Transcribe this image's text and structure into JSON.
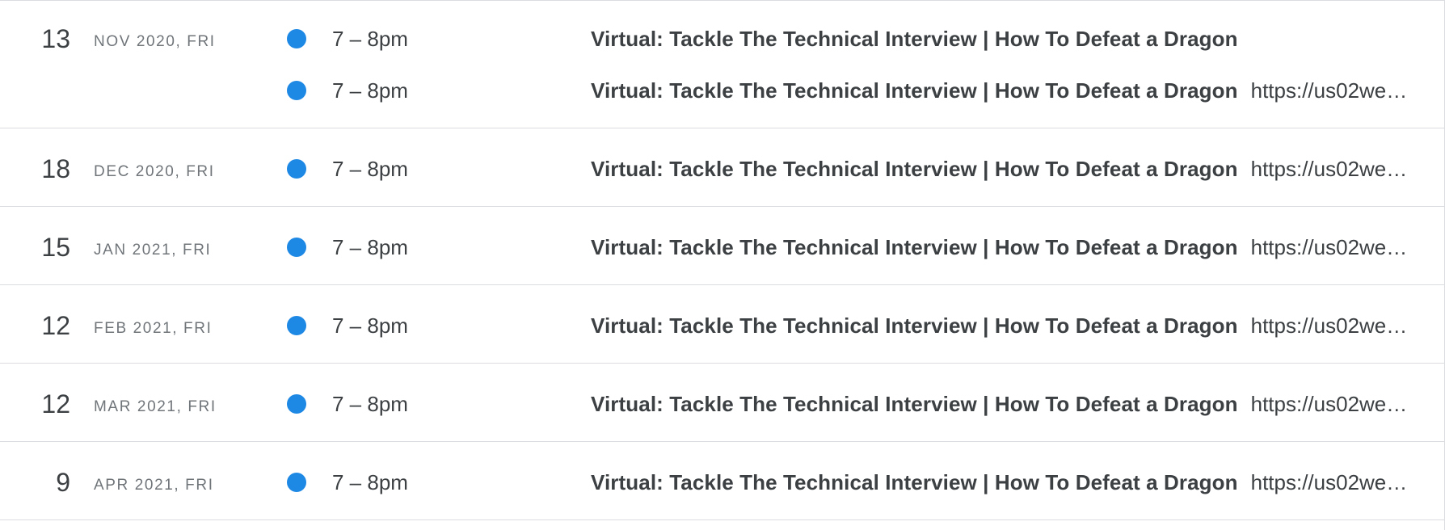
{
  "agenda": {
    "days": [
      {
        "day": "13",
        "label": "NOV 2020, FRI",
        "events": [
          {
            "time": "7 – 8pm",
            "title": "Virtual: Tackle The Technical Interview | How To Defeat a Dragon",
            "location": ""
          },
          {
            "time": "7 – 8pm",
            "title": "Virtual: Tackle The Technical Interview | How To Defeat a Dragon",
            "location": "https://us02we…"
          }
        ]
      },
      {
        "day": "18",
        "label": "DEC 2020, FRI",
        "events": [
          {
            "time": "7 – 8pm",
            "title": "Virtual: Tackle The Technical Interview | How To Defeat a Dragon",
            "location": "https://us02we…"
          }
        ]
      },
      {
        "day": "15",
        "label": "JAN 2021, FRI",
        "events": [
          {
            "time": "7 – 8pm",
            "title": "Virtual: Tackle The Technical Interview | How To Defeat a Dragon",
            "location": "https://us02we…"
          }
        ]
      },
      {
        "day": "12",
        "label": "FEB 2021, FRI",
        "events": [
          {
            "time": "7 – 8pm",
            "title": "Virtual: Tackle The Technical Interview | How To Defeat a Dragon",
            "location": "https://us02we…"
          }
        ]
      },
      {
        "day": "12",
        "label": "MAR 2021, FRI",
        "events": [
          {
            "time": "7 – 8pm",
            "title": "Virtual: Tackle The Technical Interview | How To Defeat a Dragon",
            "location": "https://us02we…"
          }
        ]
      },
      {
        "day": "9",
        "label": "APR 2021, FRI",
        "events": [
          {
            "time": "7 – 8pm",
            "title": "Virtual: Tackle The Technical Interview | How To Defeat a Dragon",
            "location": "https://us02we…"
          }
        ]
      }
    ]
  },
  "colors": {
    "event_dot": "#1e88e5",
    "divider": "#dadce0",
    "primary_text": "#3c4043",
    "secondary_text": "#70757a"
  }
}
